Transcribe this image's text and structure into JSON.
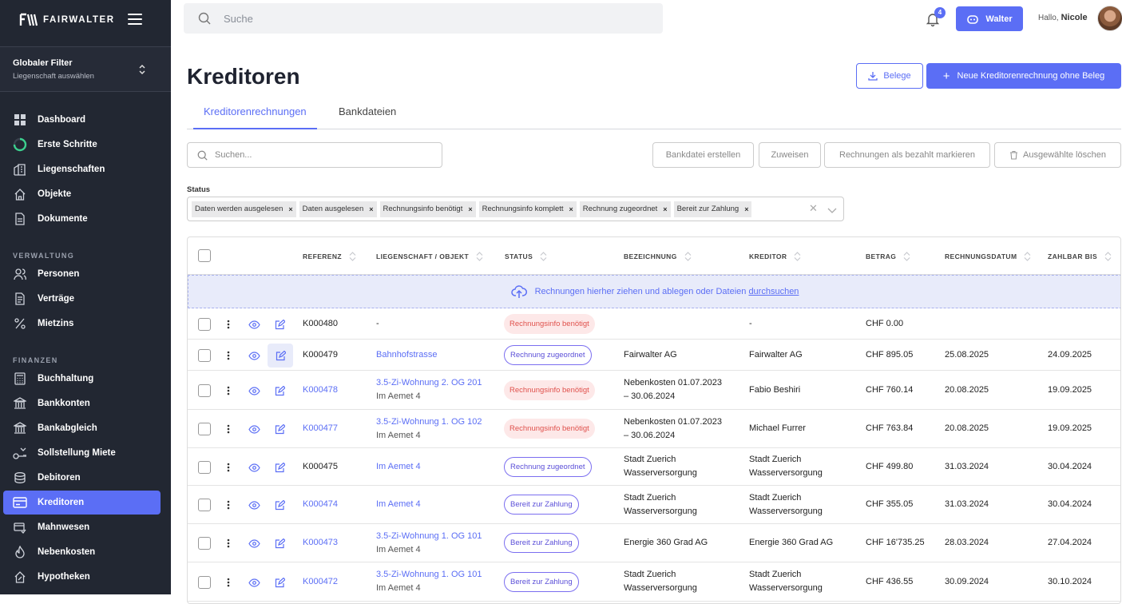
{
  "brand": {
    "name": "FAIRWALTER"
  },
  "global_filter": {
    "title": "Globaler Filter",
    "subtitle": "Liegenschaft auswählen"
  },
  "nav": {
    "main": [
      {
        "label": "Dashboard",
        "icon": "grid-icon"
      },
      {
        "label": "Erste Schritte",
        "icon": "progress-ring-icon"
      },
      {
        "label": "Liegenschaften",
        "icon": "buildings-icon"
      },
      {
        "label": "Objekte",
        "icon": "house-icon"
      },
      {
        "label": "Dokumente",
        "icon": "document-icon"
      }
    ],
    "verwaltung_title": "VERWALTUNG",
    "verwaltung": [
      {
        "label": "Personen",
        "icon": "people-icon"
      },
      {
        "label": "Verträge",
        "icon": "contract-icon"
      },
      {
        "label": "Mietzins",
        "icon": "percent-icon"
      }
    ],
    "finanzen_title": "FINANZEN",
    "finanzen": [
      {
        "label": "Buchhaltung",
        "icon": "calculator-icon"
      },
      {
        "label": "Bankkonten",
        "icon": "bank-icon"
      },
      {
        "label": "Bankabgleich",
        "icon": "bank-icon"
      },
      {
        "label": "Sollstellung Miete",
        "icon": "sollstellung-icon"
      },
      {
        "label": "Debitoren",
        "icon": "coins-icon"
      },
      {
        "label": "Kreditoren",
        "icon": "card-icon"
      },
      {
        "label": "Mahnwesen",
        "icon": "dunning-icon"
      },
      {
        "label": "Nebenkosten",
        "icon": "flame-icon"
      },
      {
        "label": "Hypotheken",
        "icon": "mortgage-icon"
      }
    ]
  },
  "topbar": {
    "search_placeholder": "Suche",
    "notifications": "4",
    "assistant": "Walter",
    "greeting": "Hallo,",
    "user": "Nicole"
  },
  "page": {
    "title": "Kreditoren",
    "btn_belege": "Belege",
    "btn_new": "Neue Kreditorenrechnung ohne Beleg",
    "tabs": [
      "Kreditorenrechnungen",
      "Bankdateien"
    ],
    "search_placeholder": "Suchen...",
    "actions": [
      "Bankdatei erstellen",
      "Zuweisen",
      "Rechnungen als bezahlt markieren",
      "Ausgewählte löschen"
    ],
    "status_label": "Status",
    "status_chips": [
      "Daten werden ausgelesen",
      "Daten ausgelesen",
      "Rechnungsinfo benötigt",
      "Rechnungsinfo komplett",
      "Rechnung zugeordnet",
      "Bereit zur Zahlung"
    ],
    "drop_text": "Rechnungen hierher ziehen und ablegen oder Dateien",
    "drop_link": "durchsuchen"
  },
  "table": {
    "columns": [
      "REFERENZ",
      "LIEGENSCHAFT / OBJEKT",
      "STATUS",
      "BEZEICHNUNG",
      "KREDITOR",
      "BETRAG",
      "RECHNUNGSDATUM",
      "ZAHLBAR BIS"
    ],
    "rows": [
      {
        "ref": "K000480",
        "ref_link": false,
        "obj": "-",
        "obj_sub": "",
        "obj_link": false,
        "status": "Rechnungsinfo benötigt",
        "status_kind": "red",
        "bez": "",
        "bez2": "",
        "kred": "-",
        "kred2": "",
        "betrag": "CHF 0.00",
        "datum": "",
        "zahlbar": ""
      },
      {
        "ref": "K000479",
        "ref_link": false,
        "obj": "Bahnhofstrasse",
        "obj_sub": "",
        "obj_link": true,
        "status": "Rechnung zugeordnet",
        "status_kind": "outline",
        "bez": "Fairwalter AG",
        "bez2": "",
        "kred": "Fairwalter AG",
        "kred2": "",
        "betrag": "CHF 895.05",
        "datum": "25.08.2025",
        "zahlbar": "24.09.2025"
      },
      {
        "ref": "K000478",
        "ref_link": true,
        "obj": "3.5-Zi-Wohnung 2. OG 201",
        "obj_sub": "Im Aemet 4",
        "obj_link": true,
        "status": "Rechnungsinfo benötigt",
        "status_kind": "red",
        "bez": "Nebenkosten 01.07.2023",
        "bez2": "– 30.06.2024",
        "kred": "Fabio Beshiri",
        "kred2": "",
        "betrag": "CHF 760.14",
        "datum": "20.08.2025",
        "zahlbar": "19.09.2025"
      },
      {
        "ref": "K000477",
        "ref_link": true,
        "obj": "3.5-Zi-Wohnung 1. OG 102",
        "obj_sub": "Im Aemet 4",
        "obj_link": true,
        "status": "Rechnungsinfo benötigt",
        "status_kind": "red",
        "bez": "Nebenkosten 01.07.2023",
        "bez2": "– 30.06.2024",
        "kred": "Michael Furrer",
        "kred2": "",
        "betrag": "CHF 763.84",
        "datum": "20.08.2025",
        "zahlbar": "19.09.2025"
      },
      {
        "ref": "K000475",
        "ref_link": false,
        "obj": "Im Aemet 4",
        "obj_sub": "",
        "obj_link": true,
        "status": "Rechnung zugeordnet",
        "status_kind": "outline",
        "bez": "Stadt Zuerich",
        "bez2": "Wasserversorgung",
        "kred": "Stadt Zuerich",
        "kred2": "Wasserversorgung",
        "betrag": "CHF 499.80",
        "datum": "31.03.2024",
        "zahlbar": "30.04.2024"
      },
      {
        "ref": "K000474",
        "ref_link": true,
        "obj": "Im Aemet 4",
        "obj_sub": "",
        "obj_link": true,
        "status": "Bereit zur Zahlung",
        "status_kind": "outline",
        "bez": "Stadt Zuerich",
        "bez2": "Wasserversorgung",
        "kred": "Stadt Zuerich",
        "kred2": "Wasserversorgung",
        "betrag": "CHF 355.05",
        "datum": "31.03.2024",
        "zahlbar": "30.04.2024"
      },
      {
        "ref": "K000473",
        "ref_link": true,
        "obj": "3.5-Zi-Wohnung 1. OG 101",
        "obj_sub": "Im Aemet 4",
        "obj_link": true,
        "status": "Bereit zur Zahlung",
        "status_kind": "outline",
        "bez": "Energie 360 Grad AG",
        "bez2": "",
        "kred": "Energie 360 Grad AG",
        "kred2": "",
        "betrag": "CHF 16'735.25",
        "datum": "28.03.2024",
        "zahlbar": "27.04.2024"
      },
      {
        "ref": "K000472",
        "ref_link": true,
        "obj": "3.5-Zi-Wohnung 1. OG 101",
        "obj_sub": "Im Aemet 4",
        "obj_link": true,
        "status": "Bereit zur Zahlung",
        "status_kind": "outline",
        "bez": "Stadt Zuerich",
        "bez2": "Wasserversorgung",
        "kred": "Stadt Zuerich",
        "kred2": "Wasserversorgung",
        "betrag": "CHF 436.55",
        "datum": "30.09.2024",
        "zahlbar": "30.10.2024"
      }
    ]
  },
  "colors": {
    "accent": "#5b6ef5",
    "sidebar": "#222732",
    "danger": "#e0524d"
  }
}
